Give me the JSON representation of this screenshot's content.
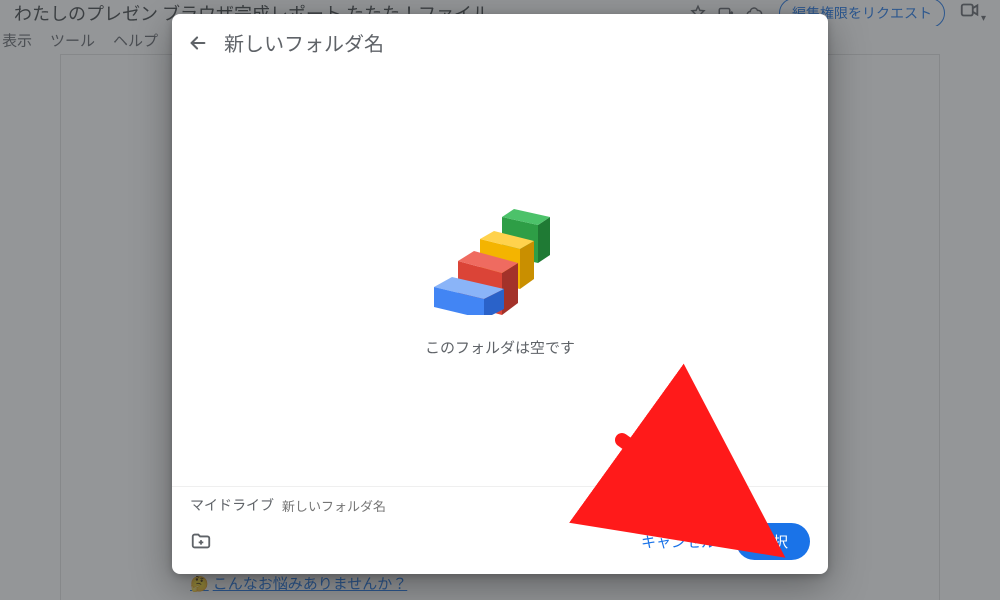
{
  "background": {
    "doc_title_fragment": "わたしのプレゼン ブラウザ完成レポート たたた！ファイル...",
    "menubar": {
      "view": "表示",
      "tools": "ツール",
      "help": "ヘルプ"
    },
    "request_edit": "編集権限をリクエスト",
    "bottom_link": "こんなお悩みありませんか？"
  },
  "dialog": {
    "title": "新しいフォルダ名",
    "empty_message": "このフォルダは空です",
    "breadcrumb": {
      "root": "マイドライブ",
      "current": "新しいフォルダ名"
    },
    "cancel_label": "キャンセル",
    "select_label": "選択"
  }
}
